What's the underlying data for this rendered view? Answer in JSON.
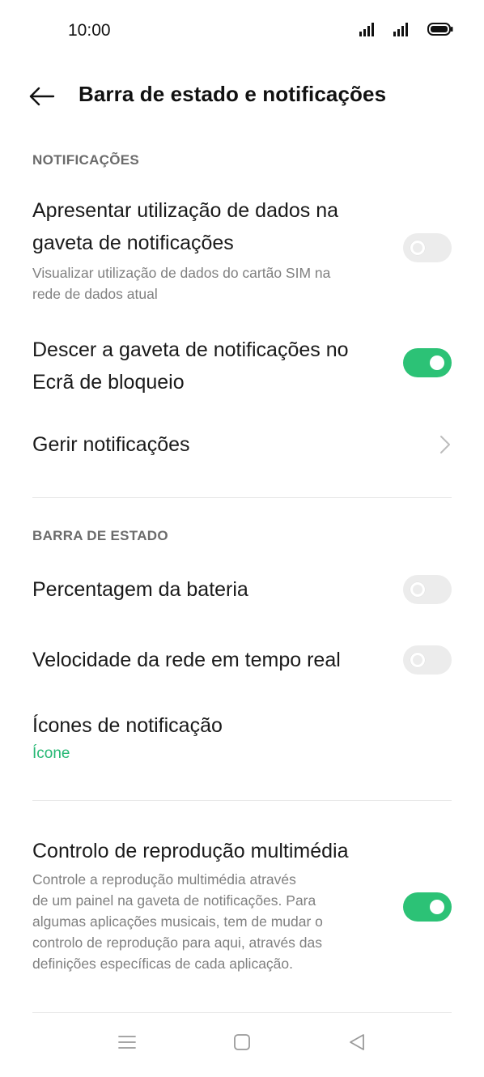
{
  "status_bar": {
    "time": "10:00",
    "icons": [
      "signal-icon",
      "signal-icon",
      "battery-icon"
    ]
  },
  "header": {
    "back_icon": "arrow-left-icon",
    "title": "Barra de estado e notificações"
  },
  "sections": {
    "notifications": {
      "label": "NOTIFICAÇÕES",
      "items": [
        {
          "title_line1": "Apresentar utilização de dados na",
          "title_line2": "gaveta de notificações",
          "subtitle_line1": "Visualizar utilização de dados do cartão SIM na",
          "subtitle_line2": "rede de dados atual",
          "toggle": "off"
        },
        {
          "title_line1": "Descer a gaveta de notificações no",
          "title_line2": "Ecrã de bloqueio",
          "toggle": "on"
        },
        {
          "title": "Gerir notificações",
          "icon": "chevron-right-icon"
        }
      ]
    },
    "status_bar_section": {
      "label": "BARRA DE ESTADO",
      "items": [
        {
          "title": "Percentagem da bateria",
          "toggle": "off"
        },
        {
          "title": "Velocidade da rede em tempo real",
          "toggle": "off"
        },
        {
          "title": "Ícones de notificação",
          "value": "Ícone"
        }
      ]
    },
    "media": {
      "items": [
        {
          "title": "Controlo de reprodução multimédia",
          "subtitle_lines": [
            "Controle a reprodução multimédia através",
            "de um painel na gaveta de notificações. Para",
            "algumas aplicações musicais, tem de mudar o",
            "controlo de reprodução para aqui, através das",
            "definições específicas de cada aplicação."
          ],
          "toggle": "on"
        }
      ]
    }
  },
  "nav_bar": {
    "icons": [
      "menu-icon",
      "home-icon",
      "back-triangle-icon"
    ]
  },
  "colors": {
    "accent": "#2cc276",
    "value_text": "#26b874",
    "toggle_off": "#ececec",
    "section_label": "#6b6b6b",
    "subtitle": "#808080"
  }
}
